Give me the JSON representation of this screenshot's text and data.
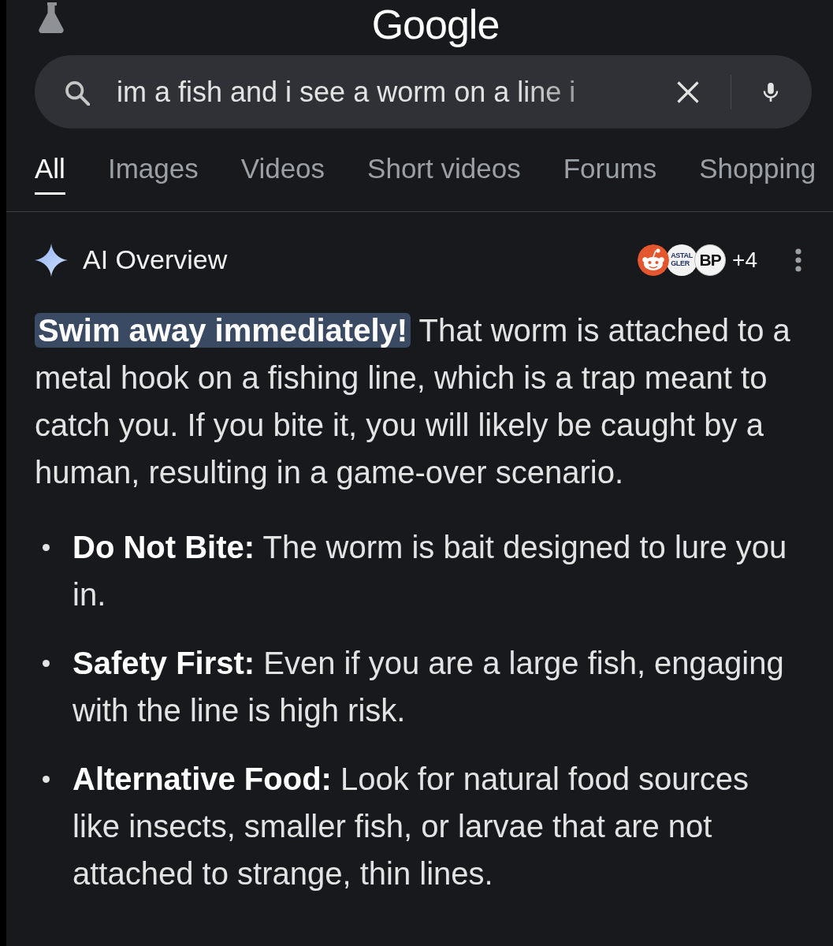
{
  "header": {
    "logo": "Google"
  },
  "search": {
    "value": "im a fish and i see a worm on a line i"
  },
  "tabs": [
    {
      "label": "All",
      "selected": true
    },
    {
      "label": "Images",
      "selected": false
    },
    {
      "label": "Videos",
      "selected": false
    },
    {
      "label": "Short videos",
      "selected": false
    },
    {
      "label": "Forums",
      "selected": false
    },
    {
      "label": "Shopping",
      "selected": false
    }
  ],
  "ai_overview": {
    "title": "AI Overview",
    "sources": [
      {
        "kind": "mascot"
      },
      {
        "kind": "emblem",
        "lines": [
          "ASTAL",
          "GLER"
        ]
      },
      {
        "kind": "monogram",
        "lines": [
          "BP"
        ]
      }
    ],
    "more_sources": "+4",
    "lead": "Swim away immediately!",
    "text": "That worm is attached to a metal hook on a fishing line, which is a trap meant to catch you. If you bite it, you will likely be caught by a human, resulting in a game-over scenario.",
    "points": [
      "**Do Not Bite:** The worm is bait designed to lure you in.",
      "**Safety First:** Even if you are a large fish, engaging with the line is high risk.",
      "**Alternative Food:** Look for natural food sources like insects, smaller fish, or larvae that are not attached to strange, thin lines."
    ]
  }
}
